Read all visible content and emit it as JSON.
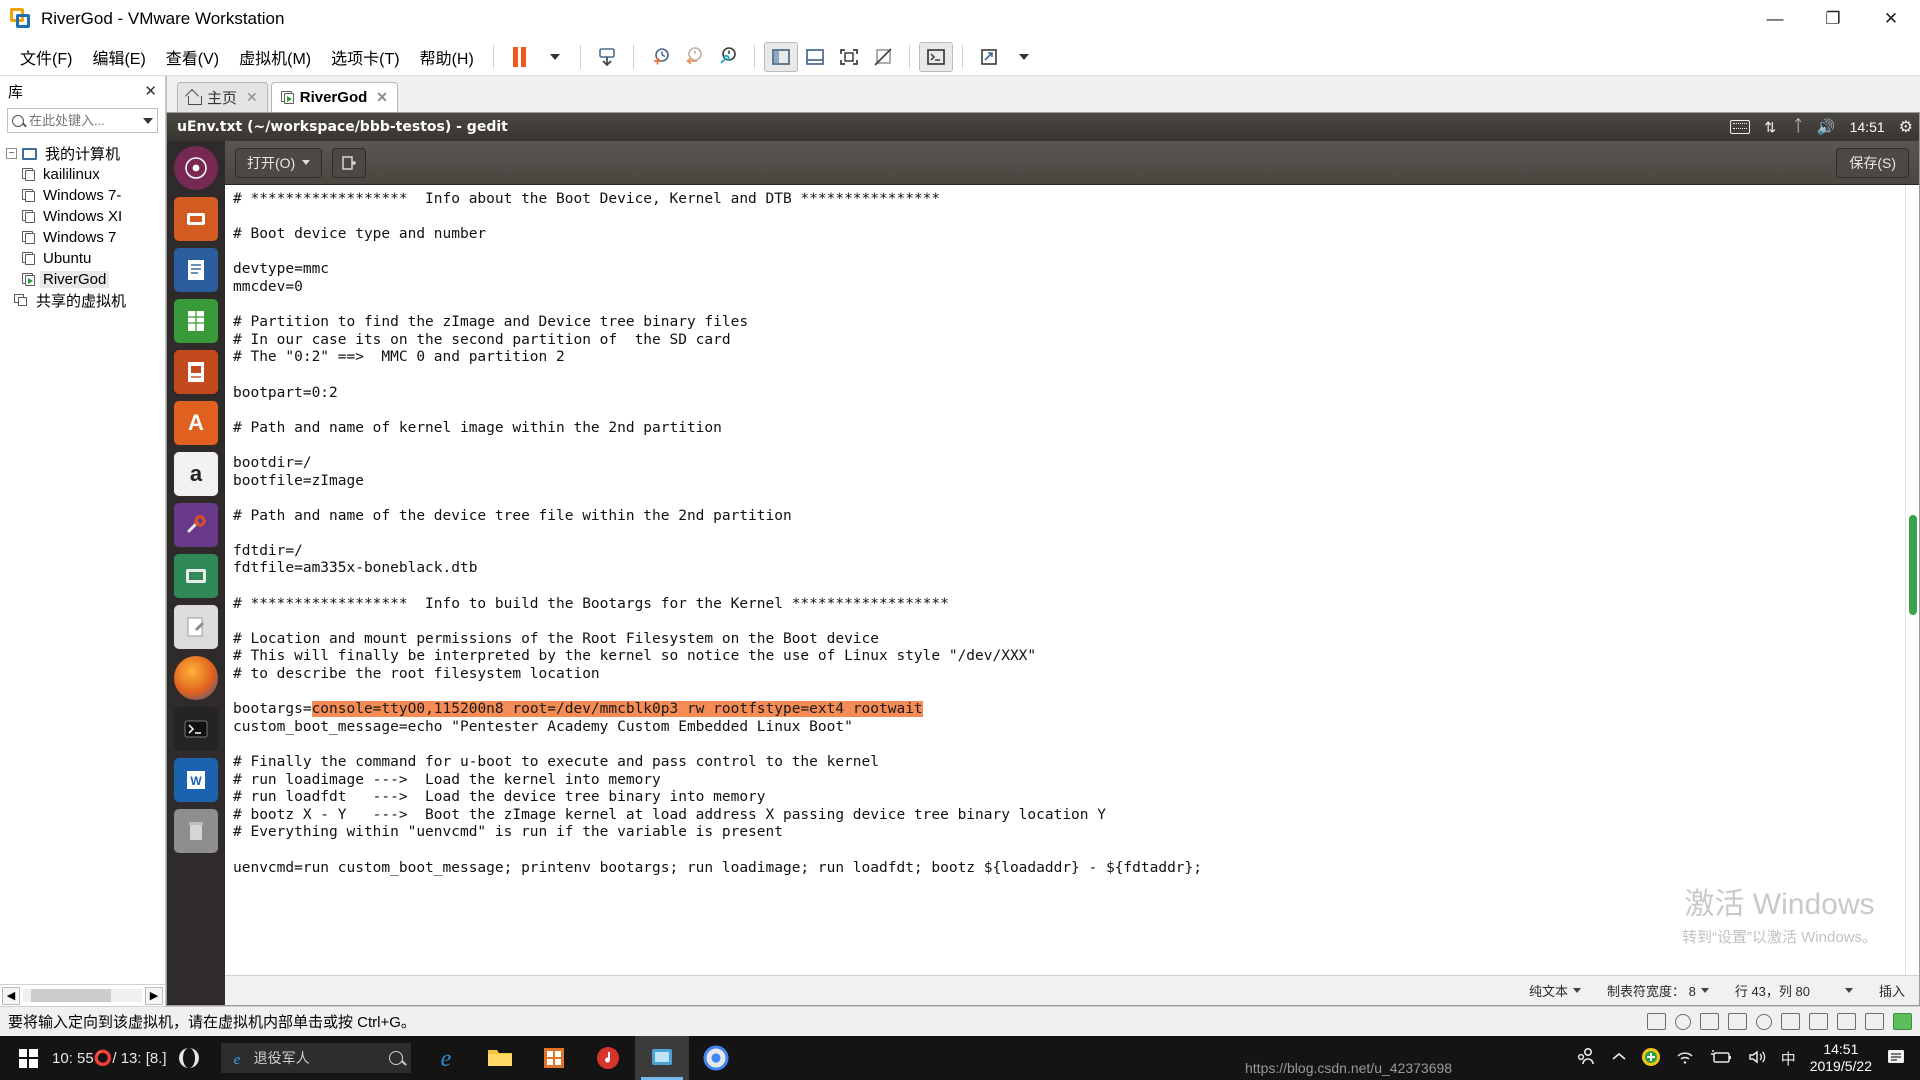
{
  "window": {
    "title": "RiverGod - VMware Workstation",
    "logo_icon": "vmware-logo-icon",
    "minimize_label": "—",
    "maximize_label": "❐",
    "close_label": "✕"
  },
  "menubar": {
    "items": [
      {
        "label": "文件(F)",
        "name": "menu-file"
      },
      {
        "label": "编辑(E)",
        "name": "menu-edit"
      },
      {
        "label": "查看(V)",
        "name": "menu-view"
      },
      {
        "label": "虚拟机(M)",
        "name": "menu-vm"
      },
      {
        "label": "选项卡(T)",
        "name": "menu-tabs"
      },
      {
        "label": "帮助(H)",
        "name": "menu-help"
      }
    ],
    "toolbar": {
      "pause_icon": "pause-icon",
      "snapshot_icon": "snapshot-icon",
      "take_snapshot_icon": "take-snapshot-icon",
      "revert_snapshot_icon": "revert-snapshot-icon",
      "manage_snapshot_icon": "manage-snapshots-icon",
      "show_library_icon": "show-library-icon",
      "show_thumbnails_icon": "show-thumbnail-bar-icon",
      "fullscreen_icon": "enter-fullscreen-icon",
      "unity_icon": "unity-mode-icon",
      "console_icon": "console-view-icon",
      "stretch_icon": "stretch-guest-icon"
    }
  },
  "sidebar": {
    "title": "库",
    "close_icon": "close-icon",
    "search": {
      "placeholder": "在此处键入...",
      "value": "",
      "icon": "search-icon",
      "dropdown_icon": "chevron-down-icon"
    },
    "tree": {
      "root": {
        "label": "我的计算机",
        "icon": "my-computer-icon",
        "expander": "−"
      },
      "items": [
        {
          "label": "kaililinux",
          "icon": "vm-icon",
          "running": false
        },
        {
          "label": "Windows 7-",
          "icon": "vm-icon",
          "running": false
        },
        {
          "label": "Windows XI",
          "icon": "vm-icon",
          "running": false
        },
        {
          "label": "Windows 7",
          "icon": "vm-icon",
          "running": false
        },
        {
          "label": "Ubuntu",
          "icon": "vm-icon",
          "running": false
        },
        {
          "label": "RiverGod",
          "icon": "vm-running-icon",
          "running": true
        }
      ],
      "shared": {
        "label": "共享的虚拟机",
        "icon": "shared-vms-icon"
      }
    },
    "scroll_left_icon": "scroll-left-icon",
    "scroll_right_icon": "scroll-right-icon"
  },
  "tabs": [
    {
      "label": "主页",
      "icon": "home-icon",
      "close_icon": "close-icon",
      "active": false
    },
    {
      "label": "RiverGod",
      "icon": "vm-running-icon",
      "close_icon": "close-icon",
      "active": true
    }
  ],
  "guest": {
    "panel": {
      "title": "uEnv.txt (~/workspace/bbb-testos) - gedit",
      "icons": [
        "keyboard-icon",
        "network-icon",
        "bluetooth-icon",
        "volume-icon"
      ],
      "clock": "14:51",
      "power_icon": "power-gear-icon"
    },
    "launcher": [
      {
        "name": "launcher-dash-icon",
        "glyph": "●",
        "color": "#772953"
      },
      {
        "name": "launcher-files-icon",
        "glyph": "▬",
        "color": "#d35a21"
      },
      {
        "name": "launcher-writer-icon",
        "glyph": "☷",
        "color": "#3465a4"
      },
      {
        "name": "launcher-calc-icon",
        "glyph": "☷",
        "color": "#3a9a3a"
      },
      {
        "name": "launcher-impress-icon",
        "glyph": "☷",
        "color": "#c24a1e"
      },
      {
        "name": "launcher-software-center-icon",
        "glyph": "A",
        "color": "#e06020"
      },
      {
        "name": "launcher-amazon-icon",
        "glyph": "a",
        "color": "#f0f0f0"
      },
      {
        "name": "launcher-settings-icon",
        "glyph": "⚒",
        "color": "#6a3a8a"
      },
      {
        "name": "launcher-terminal-green-icon",
        "glyph": "▭",
        "color": "#2f8a57"
      },
      {
        "name": "launcher-gedit-icon",
        "glyph": "✎",
        "color": "#d7d7d7"
      },
      {
        "name": "launcher-firefox-icon",
        "glyph": "◉",
        "color": "#e06a20"
      },
      {
        "name": "launcher-terminal-icon",
        "glyph": "❯_",
        "color": "#2b2b2b"
      },
      {
        "name": "launcher-wps-icon",
        "glyph": "W",
        "color": "#d13a2a"
      },
      {
        "name": "launcher-trash-icon",
        "glyph": "Ὕ1",
        "color": "#9a9a9a"
      }
    ],
    "gedit": {
      "open_button": "打开(O)",
      "open_dropdown_icon": "chevron-down-icon",
      "new_tab_icon": "new-document-icon",
      "save_button": "保存(S)",
      "text_before": "# ******************  Info about the Boot Device, Kernel and DTB ****************\n\n# Boot device type and number\n\ndevtype=mmc\nmmcdev=0\n\n# Partition to find the zImage and Device tree binary files\n# In our case its on the second partition of  the SD card\n# The \"0:2\" ==>  MMC 0 and partition 2\n\nbootpart=0:2\n\n# Path and name of kernel image within the 2nd partition\n\nbootdir=/\nbootfile=zImage\n\n# Path and name of the device tree file within the 2nd partition\n\nfdtdir=/\nfdtfile=am335x-boneblack.dtb\n\n# ******************  Info to build the Bootargs for the Kernel ******************\n\n# Location and mount permissions of the Root Filesystem on the Boot device\n# This will finally be interpreted by the kernel so notice the use of Linux style \"/dev/XXX\"\n# to describe the root filesystem location\n\nbootargs=",
      "text_highlight": "console=ttyO0,115200n8 root=/dev/mmcblk0p3 rw rootfstype=ext4 rootwait",
      "text_after": "\ncustom_boot_message=echo \"Pentester Academy Custom Embedded Linux Boot\"\n\n# Finally the command for u-boot to execute and pass control to the kernel\n# run loadimage --->  Load the kernel into memory\n# run loadfdt   --->  Load the device tree binary into memory\n# bootz X - Y   --->  Boot the zImage kernel at load address X passing device tree binary location Y\n# Everything within \"uenvcmd\" is run if the variable is present\n\nuenvcmd=run custom_boot_message; printenv bootargs; run loadimage; run loadfdt; bootz ${loadaddr} - ${fdtaddr};",
      "statusbar": {
        "language": "纯文本",
        "tab_width": "制表符宽度： 8",
        "position": "行 43，列 80",
        "insert_mode": "插入"
      }
    },
    "watermark": {
      "line1": "激活 Windows",
      "line2": "转到“设置”以激活 Windows。"
    }
  },
  "vm_status": {
    "message": "要将输入定向到该虚拟机，请在虚拟机内部单击或按 Ctrl+G。",
    "tray_icons": [
      "hard-disk-icon",
      "cd-dvd-icon",
      "network-adapter-icon",
      "printer-icon",
      "sound-card-icon",
      "usb-icon",
      "floppy-icon",
      "display-icon",
      "camera-icon",
      "input-captured-icon"
    ]
  },
  "taskbar": {
    "start_icon": "windows-start-icon",
    "cortana_text": "10: 55⭕/ 13: [8.]",
    "search": {
      "placeholder": "退役军人",
      "icon": "edge-icon",
      "search_icon": "search-icon"
    },
    "task_view_icon": "task-view-icon",
    "apps": [
      {
        "name": "taskbar-edge-icon",
        "glyph": "e",
        "color": "#2b8fd6",
        "active": false
      },
      {
        "name": "taskbar-explorer-icon",
        "glyph": "🗀",
        "color": "#ffc83d",
        "active": false
      },
      {
        "name": "taskbar-store-icon",
        "glyph": "▦",
        "color": "#d95a1f",
        "active": false
      },
      {
        "name": "taskbar-netease-music-icon",
        "glyph": "♫",
        "color": "#d8352a",
        "active": false
      },
      {
        "name": "taskbar-vmware-icon",
        "glyph": "▣",
        "color": "#4da2d4",
        "active": true
      },
      {
        "name": "taskbar-chrome-icon",
        "glyph": "◉",
        "color": "#4285f4",
        "active": false
      }
    ],
    "tray": {
      "people_icon": "people-icon",
      "show_hidden_icon": "show-hidden-icons-icon",
      "security_icon": "security-shield-icon",
      "wifi_icon": "wifi-icon",
      "battery_icon": "battery-charging-icon",
      "volume_icon": "volume-icon",
      "ime_icon": "中",
      "time": "14:51",
      "date": "2019/5/22",
      "notification_icon": "notification-center-icon"
    },
    "url_watermark": "https://blog.csdn.net/u_42373698"
  }
}
